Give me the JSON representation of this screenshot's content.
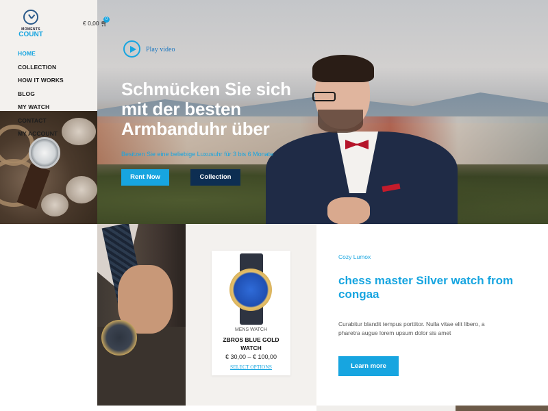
{
  "logo": {
    "top": "MOMENTS",
    "bottom": "COUNT"
  },
  "cart": {
    "total": "€ 0,00",
    "count": "0"
  },
  "nav": {
    "items": [
      {
        "label": "HOME",
        "active": true
      },
      {
        "label": "COLLECTION",
        "active": false
      },
      {
        "label": "HOW IT WORKS",
        "active": false
      },
      {
        "label": "BLOG",
        "active": false
      },
      {
        "label": "MY WATCH",
        "active": false
      },
      {
        "label": "CONTACT",
        "active": false
      },
      {
        "label": "MY ACCOUNT",
        "active": false
      }
    ]
  },
  "hero": {
    "play_label": "Play video",
    "title": "Schmücken Sie sich mit der besten Armbanduhr über",
    "subtitle": "Besitzen Sie eine beliebige Luxusuhr für 3 bis 6 Monate",
    "rent_button": "Rent Now",
    "collection_button": "Collection"
  },
  "product": {
    "category": "MENS WATCH",
    "name": "ZBROS BLUE GOLD WATCH",
    "price": "€ 30,00 – € 100,00",
    "select_label": "SELECT OPTIONS"
  },
  "feature": {
    "brand": "Cozy Lumox",
    "title": "chess master Silver watch from congaa",
    "text": "Curabitur blandit tempus porttitor. Nulla vitae elit libero, a pharetra augue lorem upsum dolor sis amet",
    "button": "Learn more"
  },
  "colors": {
    "accent": "#17a5e0",
    "navy": "#0d2e52",
    "sidebar_bg": "#f3f1ee"
  }
}
